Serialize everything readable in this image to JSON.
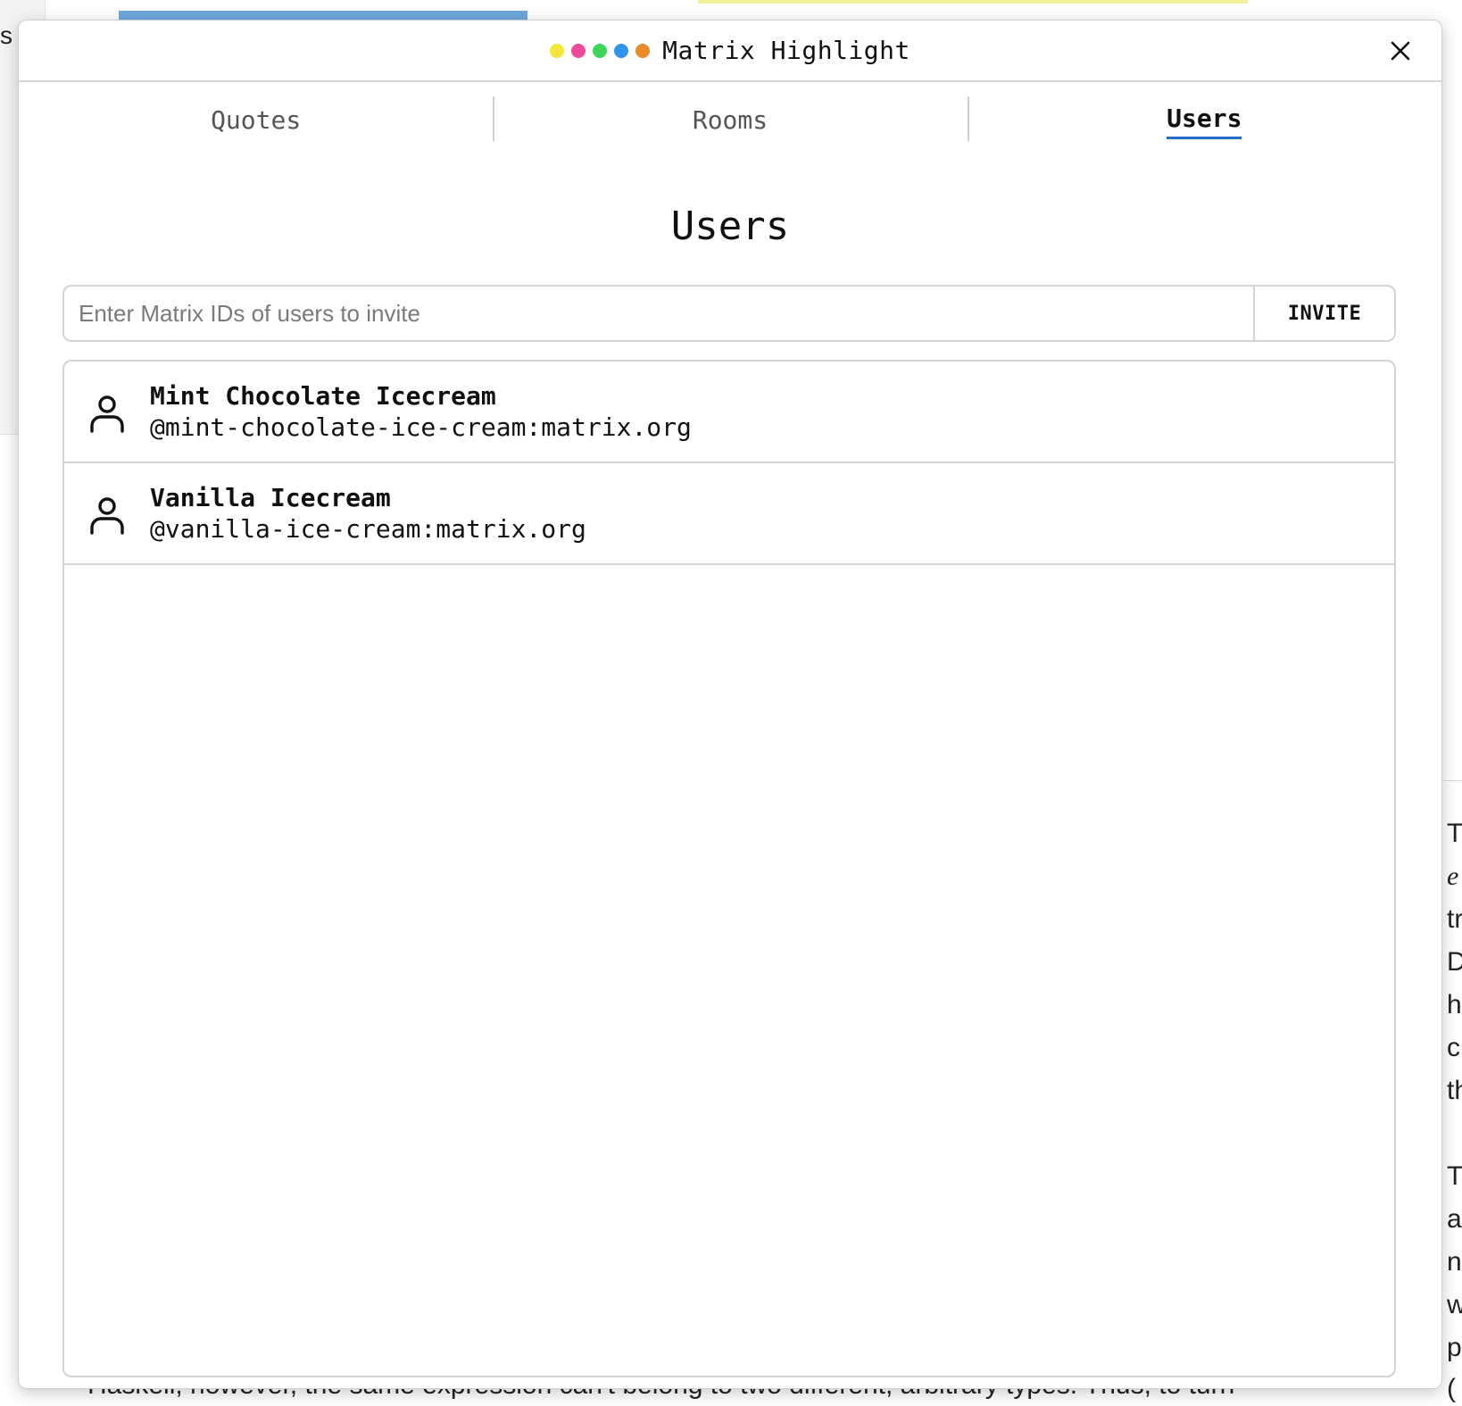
{
  "window": {
    "title": "Matrix Highlight",
    "dot_colors": [
      "#f5e63a",
      "#ee4c9a",
      "#3ed65a",
      "#2f93ea",
      "#ea8a2c"
    ]
  },
  "tabs": [
    {
      "label": "Quotes",
      "active": false
    },
    {
      "label": "Rooms",
      "active": false
    },
    {
      "label": "Users",
      "active": true
    }
  ],
  "users_view": {
    "title": "Users",
    "invite": {
      "placeholder": "Enter Matrix IDs of users to invite",
      "value": "",
      "button_label": "INVITE"
    },
    "users": [
      {
        "name": "Mint Chocolate Icecream",
        "id": "@mint-chocolate-ice-cream:matrix.org",
        "icon": "user-icon"
      },
      {
        "name": "Vanilla Icecream",
        "id": "@vanilla-ice-cream:matrix.org",
        "icon": "user-icon"
      }
    ]
  },
  "background_page": {
    "left_letter": "s",
    "bottom_text": "Haskell, however, the same expression can't belong to two different, arbitrary types. Thus, to turn",
    "right_letters": [
      "T",
      "e",
      "tr",
      "D",
      "h",
      "c",
      "th",
      "T",
      "a",
      "n",
      "w",
      "p",
      "("
    ]
  },
  "colors": {
    "active_tab_underline": "#1f6fc6",
    "border": "#d4d4d4"
  }
}
